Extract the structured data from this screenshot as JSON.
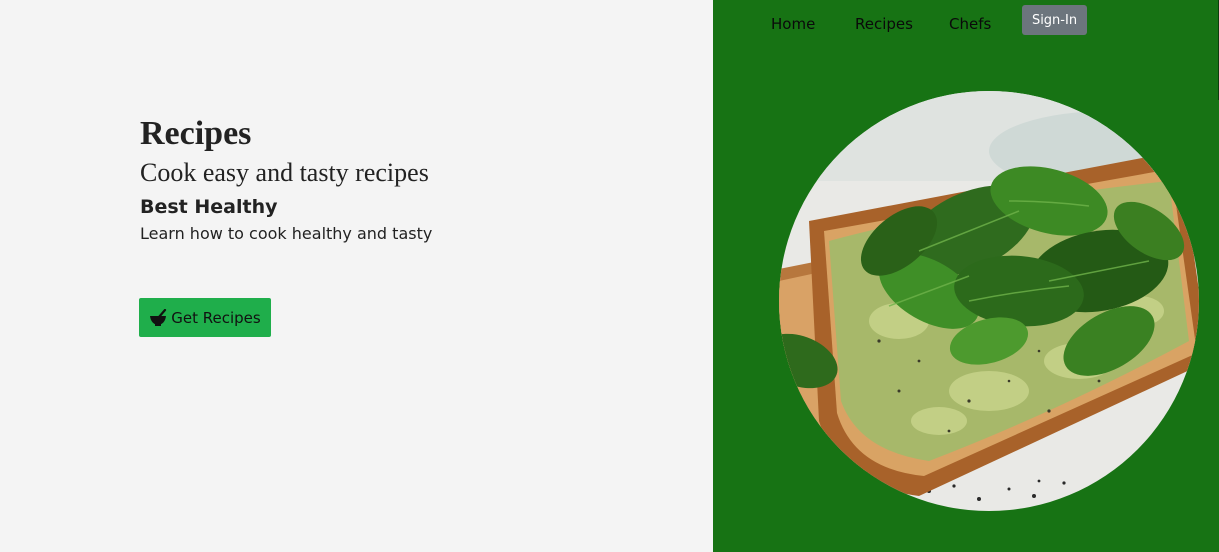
{
  "nav": {
    "links": [
      {
        "label": "Home"
      },
      {
        "label": "Recipes"
      },
      {
        "label": "Chefs"
      }
    ],
    "signin_label": "Sign-In"
  },
  "hero": {
    "title": "Recipes",
    "subtitle": "Cook easy and tasty recipes",
    "heading": "Best Healthy",
    "description": "Learn how to cook healthy and tasty",
    "cta": {
      "label": "Get Recipes",
      "icon": "mortar-bowl-icon"
    }
  },
  "image": {
    "subject": "avocado-spinach-toast-photo"
  },
  "colors": {
    "page_background": "#f4f4f4",
    "nav_panel": "#177314",
    "cta_button": "#1fae4b",
    "signin_button": "#6c757d"
  }
}
